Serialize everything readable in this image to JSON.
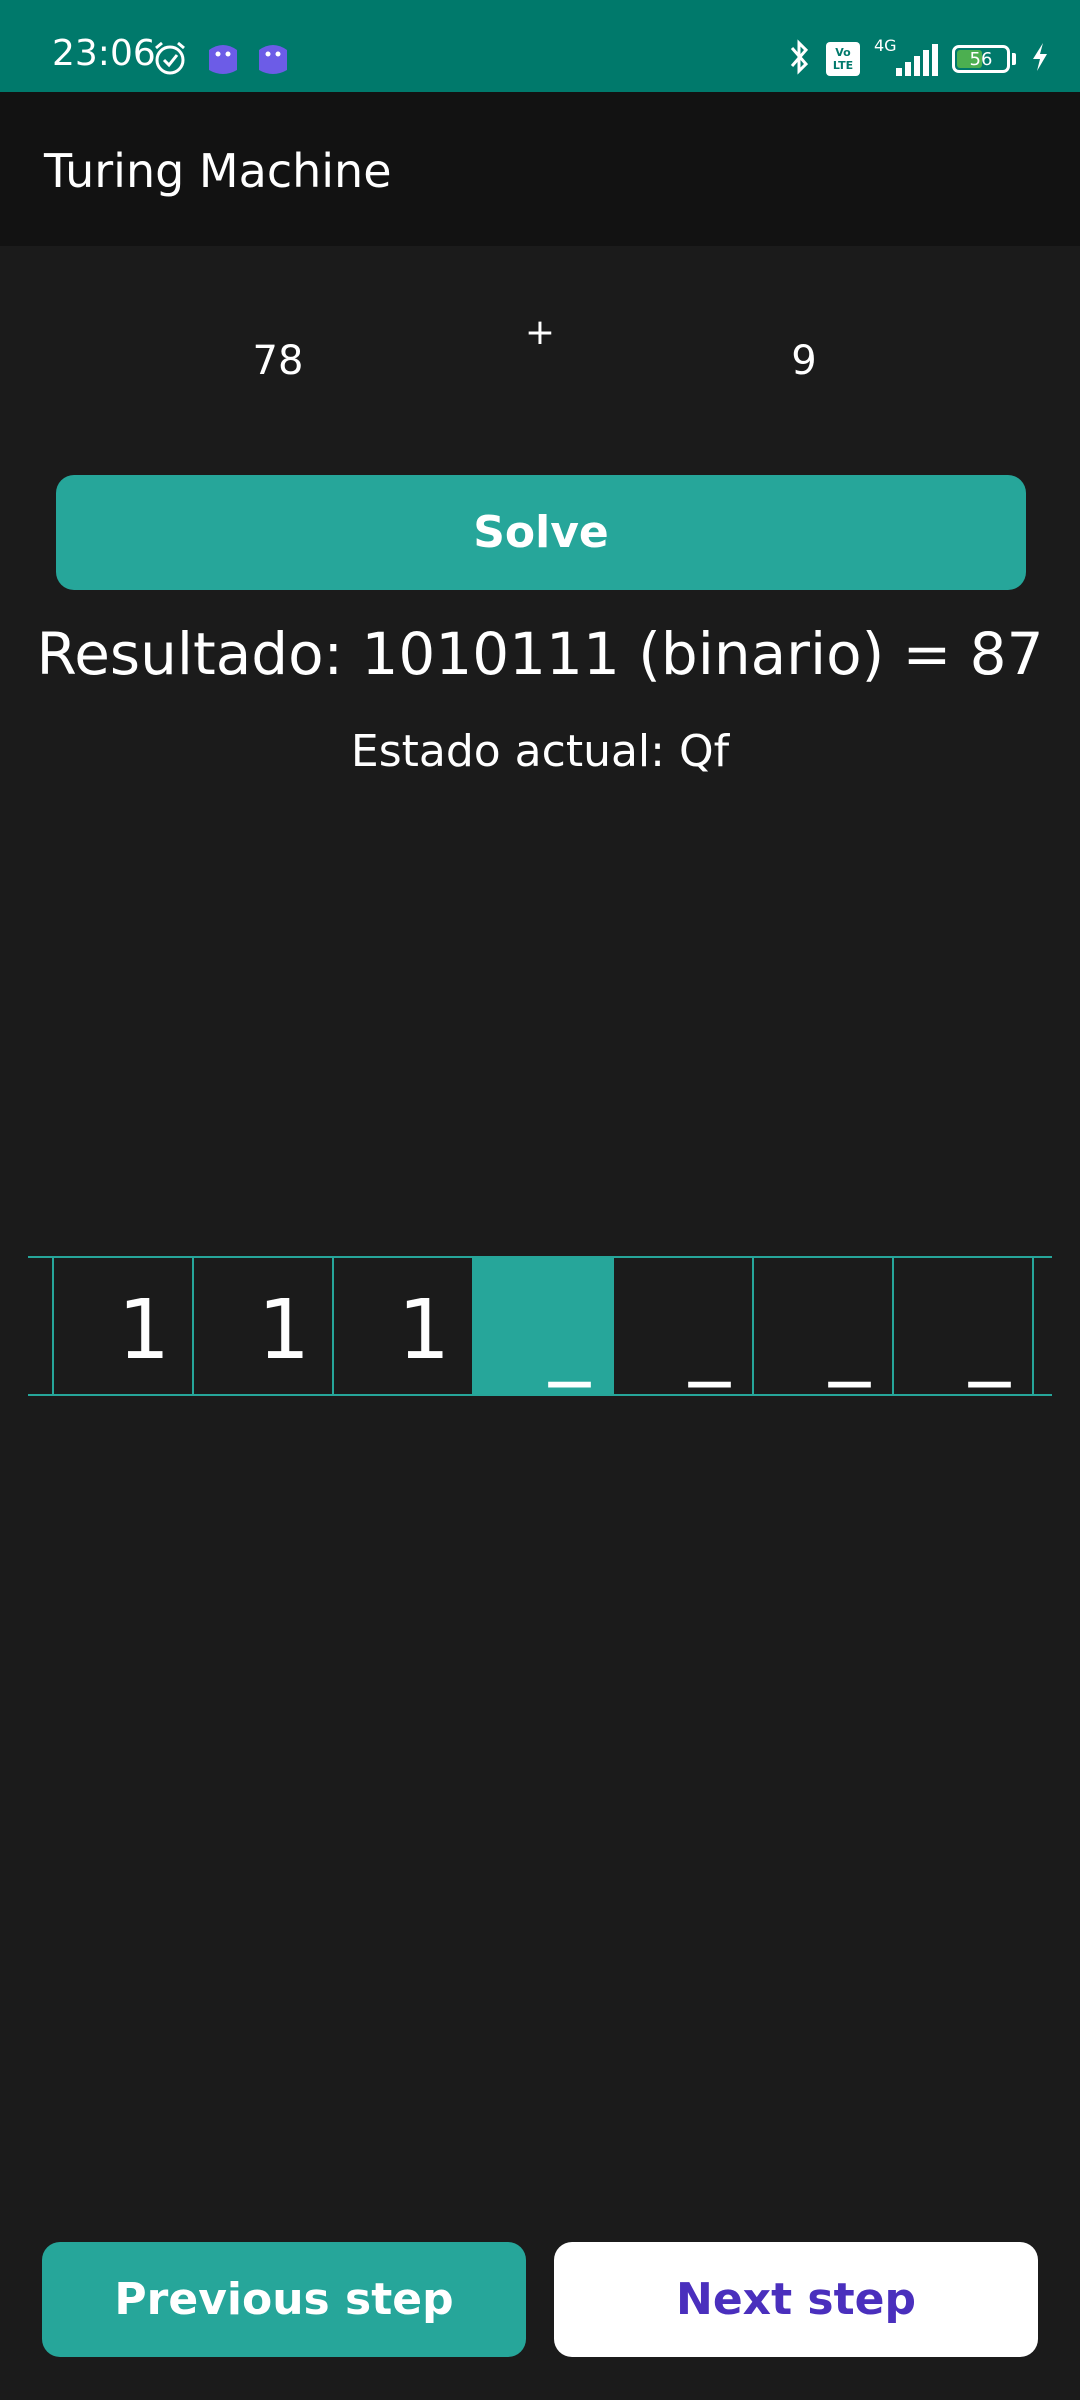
{
  "status_bar": {
    "time": "23:06",
    "network_label": "4G",
    "volte_top": "Vo",
    "volte_bottom": "LTE",
    "battery_level": "56",
    "battery_fraction": 0.56,
    "background_color": "#00796b"
  },
  "app_bar": {
    "title": "Turing Machine"
  },
  "operation": {
    "left_operand": "78",
    "operator": "+",
    "right_operand": "9"
  },
  "solve_button": {
    "label": "Solve"
  },
  "result": {
    "text": "Resultado: 1010111 (binario) = 87"
  },
  "state": {
    "text": "Estado actual: Qf"
  },
  "tape": {
    "cells": [
      "1",
      "1",
      "1",
      "_",
      "_",
      "_",
      "_"
    ],
    "head_index": 3,
    "accent_color": "#26a69a"
  },
  "navigation": {
    "previous_label": "Previous step",
    "next_label": "Next step"
  },
  "colors": {
    "accent": "#26a69a",
    "background": "#1b1b1b",
    "app_bar": "#121212",
    "next_text": "#4a2fbd"
  }
}
